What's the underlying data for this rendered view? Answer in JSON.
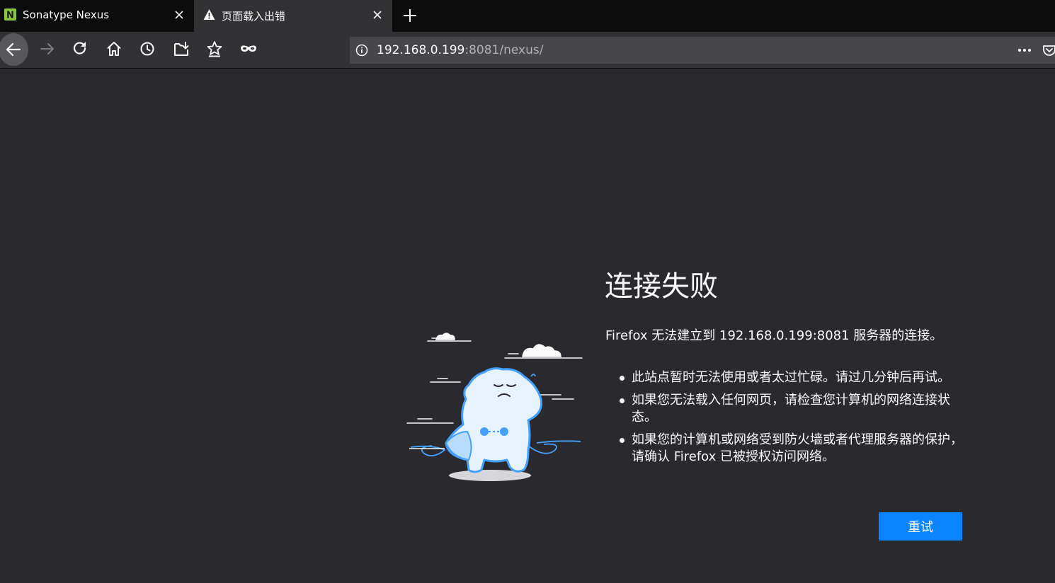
{
  "tabs": [
    {
      "label": "Sonatype Nexus",
      "icon": "nexus-favicon",
      "icon_letter": "N",
      "active": false
    },
    {
      "label": "页面载入出错",
      "icon": "warning-icon",
      "active": true
    }
  ],
  "toolbar": {
    "buttons": [
      "back-icon",
      "forward-icon",
      "reload-icon",
      "home-icon",
      "history-icon",
      "downloads-icon",
      "bookmarks-icon",
      "private-mask-icon"
    ]
  },
  "urlbar": {
    "host": "192.168.0.199",
    "rest": ":8081/nexus/"
  },
  "error": {
    "title": "连接失败",
    "description": "Firefox 无法建立到 192.168.0.199:8081 服务器的连接。",
    "reasons": [
      "此站点暂时无法使用或者太过忙碌。请过几分钟后再试。",
      "如果您无法载入任何网页，请检查您计算机的网络连接状态。",
      "如果您的计算机或网络受到防火墙或者代理服务器的保护，请确认 Firefox 已被授权访问网络。"
    ],
    "retry_label": "重试"
  },
  "colors": {
    "accent": "#0a84ff",
    "page_background": "#2a2a2e",
    "toolbar": "#323234",
    "tabstrip": "#0c0c0d",
    "illustration_blue": "#45a1ff"
  }
}
